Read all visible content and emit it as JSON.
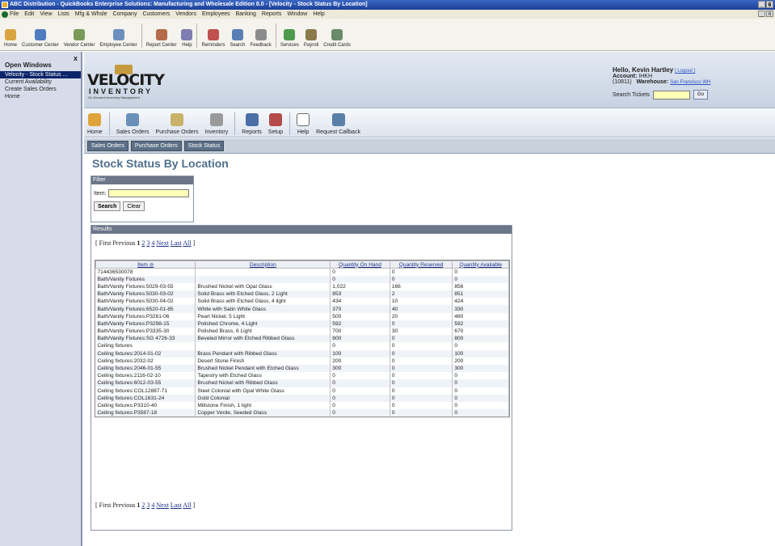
{
  "window_title": "ABC Distribution - QuickBooks Enterprise Solutions: Manufacturing and Wholesale Edition 8.0 - [Velocity - Stock Status By Location]",
  "window_controls": [
    "_",
    "6",
    "X"
  ],
  "menu": [
    "File",
    "Edit",
    "View",
    "Lists",
    "Mfg & Whsle",
    "Company",
    "Customers",
    "Vendors",
    "Employees",
    "Banking",
    "Reports",
    "Window",
    "Help"
  ],
  "toolbar": [
    {
      "label": "Home",
      "icon": "home-icon",
      "color": "#d9a441"
    },
    {
      "label": "Customer Center",
      "icon": "customer-center-icon",
      "color": "#4e7bc1"
    },
    {
      "label": "Vendor Center",
      "icon": "vendor-center-icon",
      "color": "#7a9a5a"
    },
    {
      "label": "Employee Center",
      "icon": "employee-center-icon",
      "color": "#6c8fbd"
    },
    {
      "label": "Report Center",
      "icon": "report-center-icon",
      "color": "#b46b4a"
    },
    {
      "label": "Help",
      "icon": "help-icon",
      "color": "#7d7db0"
    },
    {
      "label": "Reminders",
      "icon": "reminders-icon",
      "color": "#c0504d"
    },
    {
      "label": "Search",
      "icon": "search-icon",
      "color": "#5a7fb5"
    },
    {
      "label": "Feedback",
      "icon": "feedback-icon",
      "color": "#8c8c8c"
    },
    {
      "label": "Services",
      "icon": "services-icon",
      "color": "#4f9a4f"
    },
    {
      "label": "Payroll",
      "icon": "payroll-icon",
      "color": "#8a7a4a"
    },
    {
      "label": "Credit Cards",
      "icon": "credit-cards-icon",
      "color": "#6a8a6a"
    }
  ],
  "open_windows": {
    "title": "Open Windows",
    "close": "x",
    "items": [
      "Velocity - Stock Status ...",
      "Current Availability",
      "Create Sales Orders",
      "Home"
    ]
  },
  "header": {
    "logo_main": "VELOCITY",
    "logo_sub": "INVENTORY",
    "logo_tag": "On-Demand Inventory Management",
    "greeting": "Hello, Kevin Hartley",
    "logout": "[ Logout ]",
    "account_label": "Account:",
    "account_value": "IHKH",
    "account_id": "(10811)",
    "warehouse_label": "Warehouse:",
    "warehouse_value": "San Francisco WH",
    "search_tickets_label": "Search Tickets",
    "search_tickets_value": "",
    "go": "Go"
  },
  "nav": [
    {
      "label": "Home",
      "icon": "home-icon",
      "color": "#e0a33b"
    },
    {
      "label": "Sales Orders",
      "icon": "sales-orders-icon",
      "color": "#6a8fb8"
    },
    {
      "label": "Purchase Orders",
      "icon": "purchase-orders-icon",
      "color": "#c8b26a"
    },
    {
      "label": "Inventory",
      "icon": "inventory-icon",
      "color": "#9a9a9a"
    },
    {
      "label": "Reports",
      "icon": "reports-icon",
      "color": "#4d6fa8"
    },
    {
      "label": "Setup",
      "icon": "setup-icon",
      "color": "#b44a4a"
    },
    {
      "label": "Help",
      "icon": "help-icon",
      "color": "#ffffff"
    },
    {
      "label": "Request Callback",
      "icon": "request-callback-icon",
      "color": "#5a7fa8"
    }
  ],
  "subnav": [
    "Sales Orders",
    "Purchase Orders",
    "Stock Status"
  ],
  "page_title": "Stock Status By Location",
  "filter": {
    "header": "Filter",
    "item_label": "Item:",
    "item_value": "",
    "search": "Search",
    "clear": "Clear"
  },
  "results": {
    "header": "Results",
    "pager": {
      "open": "[",
      "first": "First",
      "previous": "Previous",
      "current": "1",
      "pages": [
        "2",
        "3",
        "4"
      ],
      "next": "Next",
      "last": "Last",
      "all": "All",
      "close": "]"
    },
    "columns": [
      "Item ⊖",
      "Description",
      "Quantity On Hand",
      "Quantity Reserved",
      "Quantity Available"
    ],
    "rows": [
      [
        "714436530078",
        "",
        "0",
        "0",
        "0"
      ],
      [
        "Bath/Vanity Fixtures",
        "",
        "0",
        "0",
        "0"
      ],
      [
        "Bath/Vanity Fixtures:5029-03-55",
        "Brushed Nickel with Opal Glass",
        "1,022",
        "166",
        "856"
      ],
      [
        "Bath/Vanity Fixtures:5030-03-02",
        "Solid Brass with Etched Glass, 2 Light",
        "853",
        "2",
        "851"
      ],
      [
        "Bath/Vanity Fixtures:5030-04-02",
        "Solid Brass with Etched Glass, 4 light",
        "434",
        "10",
        "424"
      ],
      [
        "Bath/Vanity Fixtures:6520-01-85",
        "White with Satin White Glass",
        "370",
        "40",
        "330"
      ],
      [
        "Bath/Vanity Fixtures:P3261-06",
        "Pearl Nickel, 5 Light",
        "500",
        "20",
        "480"
      ],
      [
        "Bath/Vanity Fixtures:P3298-15",
        "Polished Chrome, 4 Light",
        "592",
        "0",
        "592"
      ],
      [
        "Bath/Vanity Fixtures:P3335-30",
        "Polished Brass, 6 Light",
        "700",
        "30",
        "670"
      ],
      [
        "Bath/Vanity Fixtures:SG 4726-33",
        "Beveled Mirror with Etched Ribbed Glass",
        "800",
        "0",
        "800"
      ],
      [
        "Ceiling fixtures",
        "",
        "0",
        "0",
        "0"
      ],
      [
        "Ceiling fixtures:2014-01-02",
        "Brass Pendant with Ribbed Glass",
        "100",
        "0",
        "100"
      ],
      [
        "Ceiling fixtures:2032-02",
        "Desert Stone Finish",
        "200",
        "0",
        "200"
      ],
      [
        "Ceiling fixtures:2046-01-55",
        "Brushed Nickel Pendant with Etched Glass",
        "300",
        "0",
        "300"
      ],
      [
        "Ceiling fixtures:2116-02-10",
        "Tapestry with Etched Glass",
        "0",
        "0",
        "0"
      ],
      [
        "Ceiling fixtures:6012-03-55",
        "Brushed Nickel with Ribbed Glass",
        "0",
        "0",
        "0"
      ],
      [
        "Ceiling fixtures:COL12887-71",
        "Steel Colonial with Opal White Glass",
        "0",
        "0",
        "0"
      ],
      [
        "Ceiling fixtures:COL1631-24",
        "Gold Colonial",
        "0",
        "0",
        "0"
      ],
      [
        "Ceiling fixtures:P3310-40",
        "Millstone Finish, 1 light",
        "0",
        "0",
        "0"
      ],
      [
        "Ceiling fixtures:P3587-18",
        "Copper Verde, Seeded Glass",
        "0",
        "0",
        "0"
      ]
    ]
  }
}
